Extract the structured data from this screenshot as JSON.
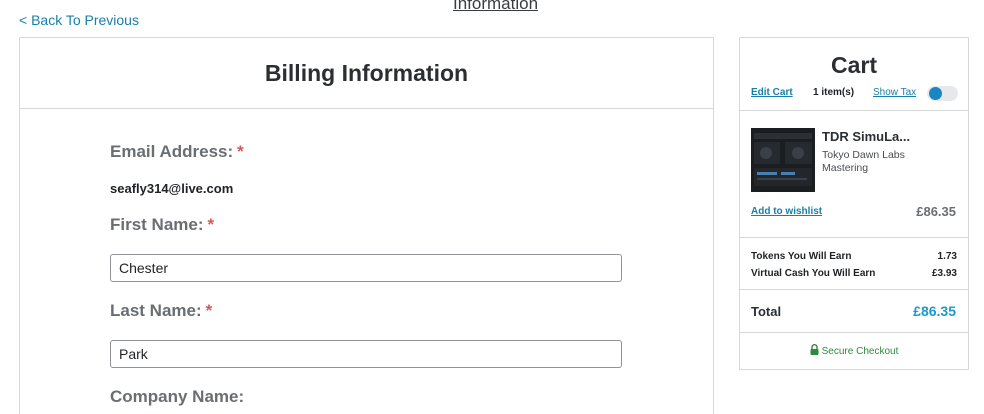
{
  "nav": {
    "back_label": "< Back To Previous",
    "top_tab_label": "Information"
  },
  "billing": {
    "title": "Billing Information",
    "email_label": "Email Address:",
    "email_value": "seafly314@live.com",
    "first_name_label": "First Name:",
    "first_name_value": "Chester",
    "last_name_label": "Last Name:",
    "last_name_value": "Park",
    "company_label": "Company Name:",
    "required_marker": "*"
  },
  "cart": {
    "title": "Cart",
    "edit_label": "Edit Cart",
    "item_count": "1 item(s)",
    "show_tax_label": "Show Tax",
    "show_tax_on": false,
    "item": {
      "name": "TDR SimuLa...",
      "vendor": "Tokyo Dawn Labs",
      "category": "Mastering",
      "price": "£86.35",
      "wishlist_label": "Add to wishlist"
    },
    "tokens_label": "Tokens You Will Earn",
    "tokens_value": "1.73",
    "virtual_cash_label": "Virtual Cash You Will Earn",
    "virtual_cash_value": "£3.93",
    "total_label": "Total",
    "total_value": "£86.35",
    "secure_label": "Secure Checkout"
  },
  "colors": {
    "link": "#1a7fa8",
    "required": "#d05a5a",
    "total": "#1a99cc",
    "secure": "#2e8b3a"
  }
}
